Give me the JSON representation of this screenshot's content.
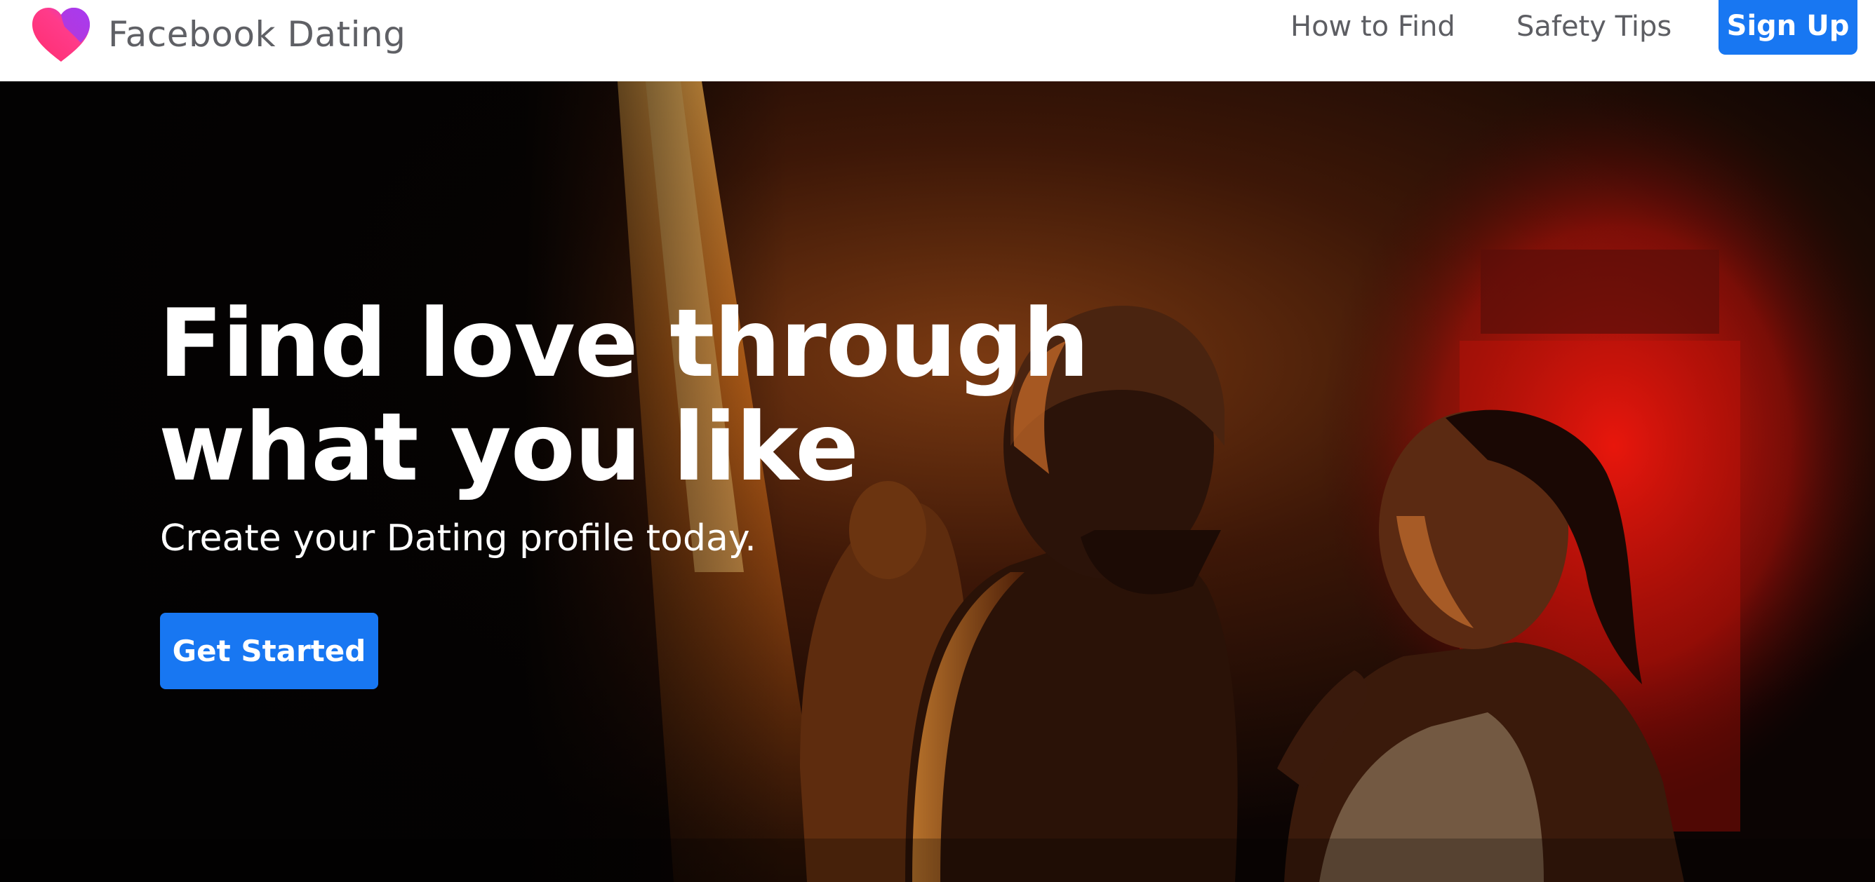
{
  "navbar": {
    "brand_name": "Facebook Dating",
    "logo_icon": "heart-logo-icon",
    "links": [
      {
        "label": "How to Find"
      },
      {
        "label": "Safety Tips"
      }
    ],
    "signup_label": "Sign Up"
  },
  "hero": {
    "headline_line1": "Find love through",
    "headline_line2": "what you like",
    "subheadline": "Create your Dating profile today.",
    "cta_label": "Get Started",
    "image_alt": "hero-photo"
  },
  "colors": {
    "accent": "#1877f2",
    "nav_text": "#5d5e63",
    "logo_pink": "#ff3b7f",
    "logo_purple": "#a033ff"
  }
}
